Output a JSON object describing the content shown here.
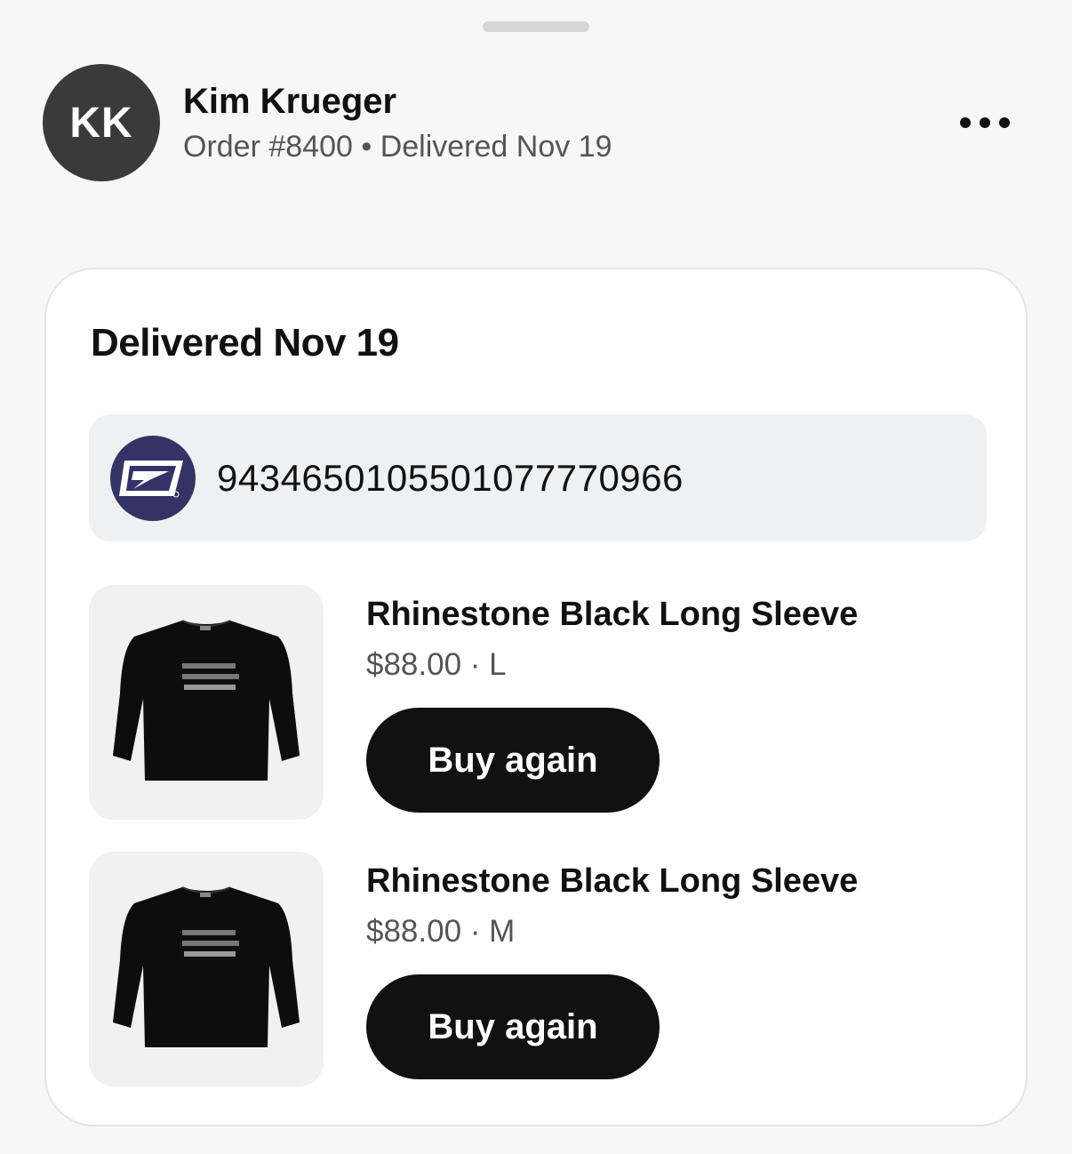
{
  "header": {
    "avatar_initials": "KK",
    "customer_name": "Kim Krueger",
    "order_meta": "Order #8400 • Delivered Nov 19"
  },
  "card": {
    "title": "Delivered Nov 19",
    "tracking": {
      "carrier_icon": "usps-eagle-icon",
      "number": "9434650105501077770966"
    },
    "items": [
      {
        "title": "Rhinestone Black Long Sleeve",
        "meta": "$88.00 · L",
        "button_label": "Buy again",
        "image_icon": "black-long-sleeve-shirt"
      },
      {
        "title": "Rhinestone Black Long Sleeve",
        "meta": "$88.00 · M",
        "button_label": "Buy again",
        "image_icon": "black-long-sleeve-shirt"
      }
    ]
  },
  "colors": {
    "usps_blue": "#333366",
    "button_bg": "#111111",
    "tracking_bg": "#eff0f2"
  }
}
